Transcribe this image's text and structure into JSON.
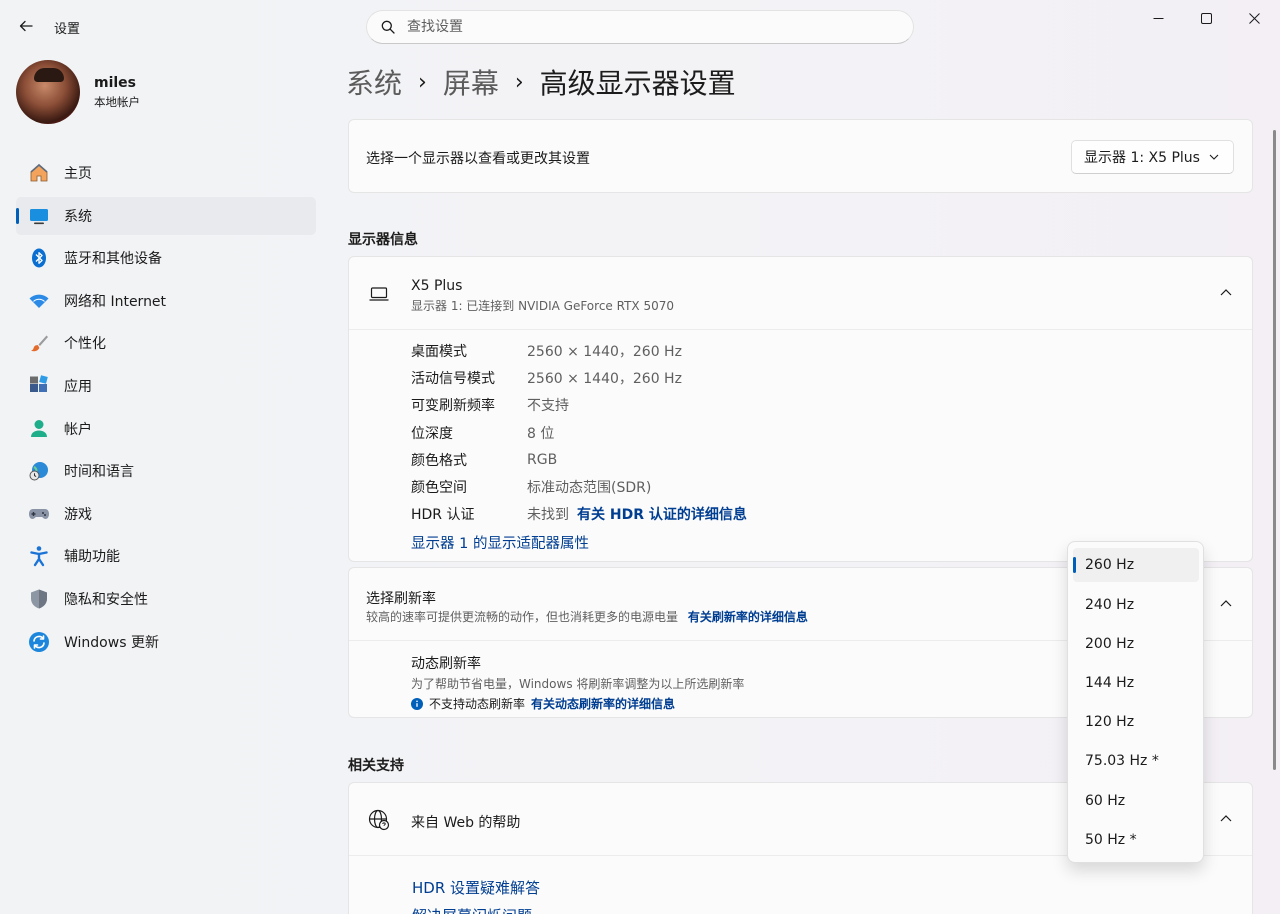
{
  "window": {
    "app_title": "设置",
    "search_placeholder": "查找设置"
  },
  "profile": {
    "name": "miles",
    "account_type": "本地帐户"
  },
  "nav": [
    {
      "label": "主页",
      "icon": "home-icon"
    },
    {
      "label": "系统",
      "icon": "monitor-icon",
      "active": true
    },
    {
      "label": "蓝牙和其他设备",
      "icon": "bluetooth-icon"
    },
    {
      "label": "网络和 Internet",
      "icon": "wifi-icon"
    },
    {
      "label": "个性化",
      "icon": "brush-icon"
    },
    {
      "label": "应用",
      "icon": "apps-icon"
    },
    {
      "label": "帐户",
      "icon": "person-icon"
    },
    {
      "label": "时间和语言",
      "icon": "globe-clock-icon"
    },
    {
      "label": "游戏",
      "icon": "gamepad-icon"
    },
    {
      "label": "辅助功能",
      "icon": "accessibility-icon"
    },
    {
      "label": "隐私和安全性",
      "icon": "shield-icon"
    },
    {
      "label": "Windows 更新",
      "icon": "update-icon"
    }
  ],
  "breadcrumb": {
    "level1": "系统",
    "level2": "屏幕",
    "current": "高级显示器设置"
  },
  "display_select": {
    "label": "选择一个显示器以查看或更改其设置",
    "value": "显示器 1: X5 Plus"
  },
  "display_info": {
    "section_title": "显示器信息",
    "name": "X5 Plus",
    "subtitle": "显示器 1: 已连接到 NVIDIA GeForce RTX 5070",
    "rows": [
      {
        "label": "桌面模式",
        "value": "2560 × 1440，260 Hz"
      },
      {
        "label": "活动信号模式",
        "value": "2560 × 1440，260 Hz"
      },
      {
        "label": "可变刷新频率",
        "value": "不支持"
      },
      {
        "label": "位深度",
        "value": "8 位"
      },
      {
        "label": "颜色格式",
        "value": "RGB"
      },
      {
        "label": "颜色空间",
        "value": "标准动态范围(SDR)"
      }
    ],
    "hdr_label": "HDR 认证",
    "hdr_value": "未找到",
    "hdr_link": "有关 HDR 认证的详细信息",
    "adapter_link": "显示器 1 的显示适配器属性"
  },
  "refresh": {
    "title": "选择刷新率",
    "desc": "较高的速率可提供更流畅的动作，但也消耗更多的电源电量",
    "desc_link": "有关刷新率的详细信息",
    "dynamic_title": "动态刷新率",
    "dynamic_desc": "为了帮助节省电量，Windows 将刷新率调整为以上所选刷新率",
    "dynamic_note": "不支持动态刷新率",
    "dynamic_link": "有关动态刷新率的详细信息",
    "options": [
      "260 Hz",
      "240 Hz",
      "200 Hz",
      "144 Hz",
      "120 Hz",
      "75.03 Hz *",
      "60 Hz",
      "50 Hz *"
    ],
    "selected": "260 Hz"
  },
  "support": {
    "section_title": "相关支持",
    "web_help": "来自 Web 的帮助",
    "links": [
      "HDR 设置疑难解答",
      "解决屏幕闪烁问题"
    ]
  },
  "colors": {
    "accent": "#005fb8",
    "link": "#003e92"
  }
}
